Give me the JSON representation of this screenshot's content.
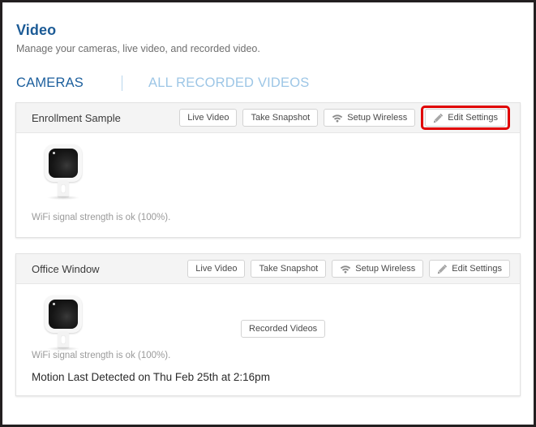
{
  "header": {
    "title": "Video",
    "subtitle": "Manage your cameras, live video, and recorded video."
  },
  "tabs": [
    {
      "label": "CAMERAS",
      "active": true
    },
    {
      "label": "ALL RECORDED VIDEOS",
      "active": false
    }
  ],
  "colors": {
    "title_blue": "#1c5b96",
    "tab_active": "#1b5e9c",
    "tab_inactive": "#9dc6e6",
    "highlight_red": "#e00000",
    "card_header_bg": "#f4f4f4",
    "button_border": "#d3d3d3"
  },
  "cards": [
    {
      "name": "Enrollment Sample",
      "buttons": [
        {
          "label": "Live Video",
          "icon": null
        },
        {
          "label": "Take Snapshot",
          "icon": null
        },
        {
          "label": "Setup Wireless",
          "icon": "wifi-icon"
        },
        {
          "label": "Edit Settings",
          "icon": "pencil-icon",
          "highlighted": true
        }
      ],
      "body_button": null,
      "wifi_status": "WiFi signal strength is ok (100%).",
      "motion_status": null,
      "camera_icon": "camera-thumbnail"
    },
    {
      "name": "Office Window",
      "buttons": [
        {
          "label": "Live Video",
          "icon": null
        },
        {
          "label": "Take Snapshot",
          "icon": null
        },
        {
          "label": "Setup Wireless",
          "icon": "wifi-icon"
        },
        {
          "label": "Edit Settings",
          "icon": "pencil-icon",
          "highlighted": false
        }
      ],
      "body_button": {
        "label": "Recorded Videos"
      },
      "wifi_status": "WiFi signal strength is ok (100%).",
      "motion_status": "Motion Last Detected on Thu Feb 25th at 2:16pm",
      "camera_icon": "camera-thumbnail"
    }
  ]
}
